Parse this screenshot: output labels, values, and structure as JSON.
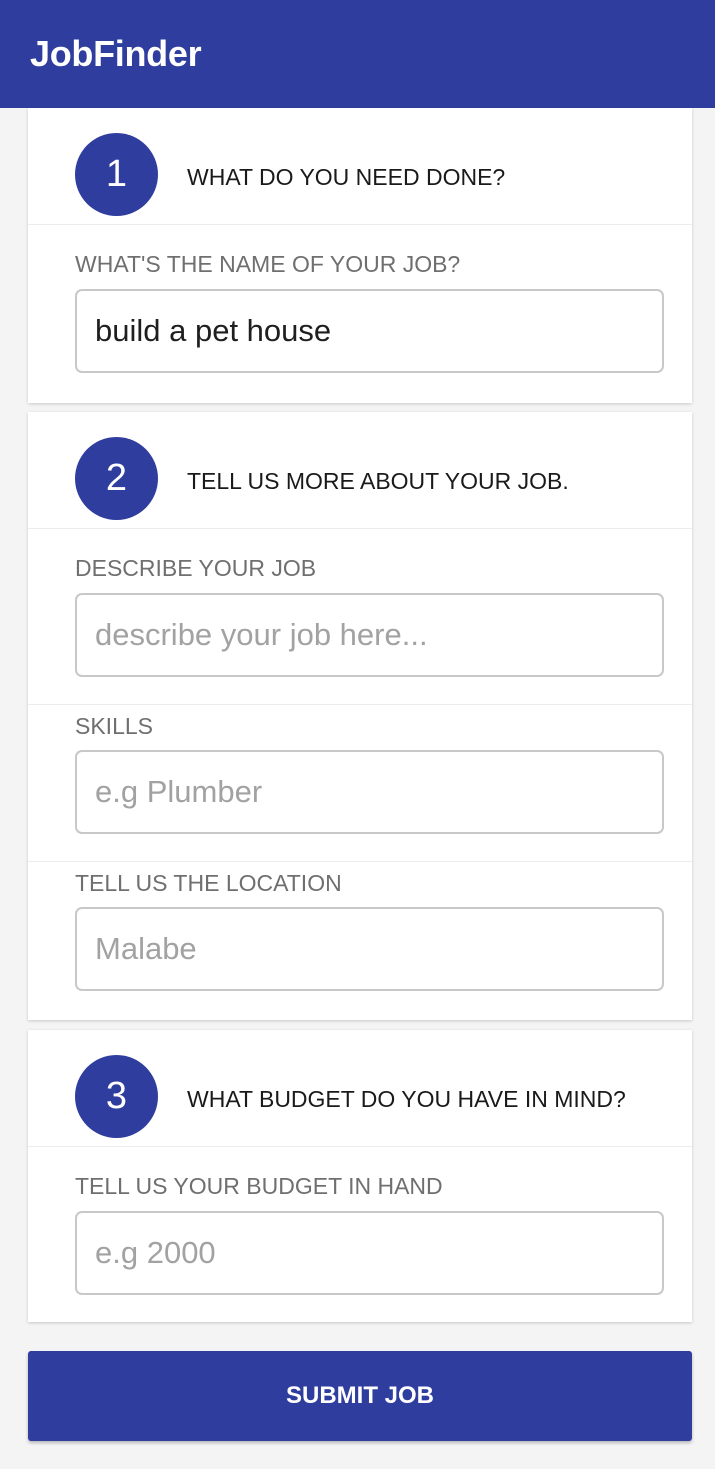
{
  "app": {
    "title": "JobFinder"
  },
  "colors": {
    "primary": "#2f3e9e",
    "background": "#f4f4f4"
  },
  "steps": [
    {
      "number": "1",
      "title": "WHAT DO YOU NEED DONE?",
      "fields": [
        {
          "label": "WHAT'S THE NAME OF YOUR JOB?",
          "value": "build a pet house",
          "placeholder": ""
        }
      ]
    },
    {
      "number": "2",
      "title": "TELL US MORE ABOUT YOUR JOB.",
      "fields": [
        {
          "label": "DESCRIBE YOUR JOB",
          "value": "",
          "placeholder": "describe your job here..."
        },
        {
          "label": "SKILLS",
          "value": "",
          "placeholder": "e.g Plumber"
        },
        {
          "label": "TELL US THE LOCATION",
          "value": "",
          "placeholder": "Malabe"
        }
      ]
    },
    {
      "number": "3",
      "title": "WHAT BUDGET DO YOU HAVE IN MIND?",
      "fields": [
        {
          "label": "TELL US YOUR BUDGET IN HAND",
          "value": "",
          "placeholder": "e.g 2000"
        }
      ]
    }
  ],
  "submit": {
    "label": "SUBMIT JOB"
  }
}
